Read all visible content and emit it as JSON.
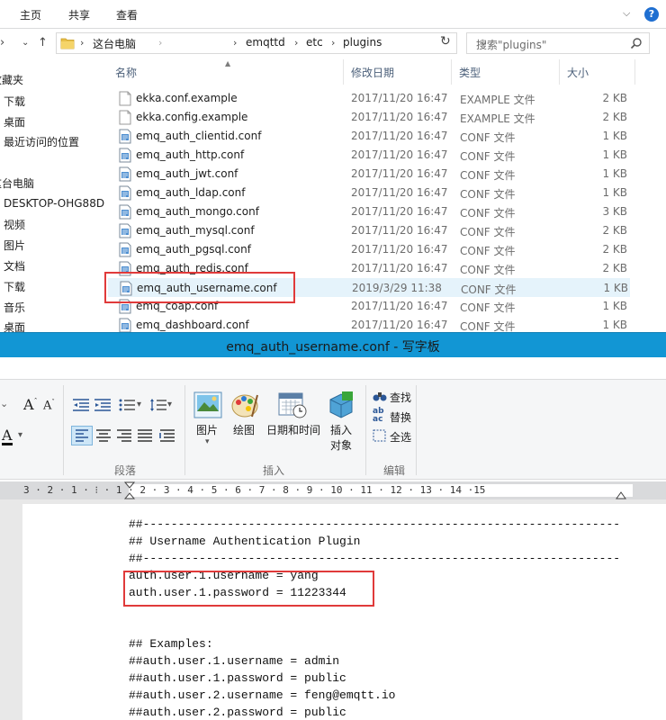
{
  "explorer": {
    "ribbon_tabs": [
      "主页",
      "共享",
      "查看"
    ],
    "address": {
      "root": "这台电脑",
      "segments": [
        "emqttd",
        "etc",
        "plugins"
      ]
    },
    "search_placeholder": "搜索\"plugins\"",
    "sidebar": {
      "quick_access": "收藏夹",
      "favorites": [
        "下载",
        "桌面",
        "最近访问的位置"
      ],
      "this_pc": "这台电脑",
      "pc_items": [
        "DESKTOP-OHG88D",
        "视频",
        "图片",
        "文档",
        "下载",
        "音乐",
        "桌面"
      ]
    },
    "columns": {
      "name": "名称",
      "date": "修改日期",
      "type": "类型",
      "size": "大小"
    },
    "files": [
      {
        "name": "ekka.conf.example",
        "date": "2017/11/20 16:47",
        "type": "EXAMPLE 文件",
        "size": "2 KB"
      },
      {
        "name": "ekka.config.example",
        "date": "2017/11/20 16:47",
        "type": "EXAMPLE 文件",
        "size": "2 KB"
      },
      {
        "name": "emq_auth_clientid.conf",
        "date": "2017/11/20 16:47",
        "type": "CONF 文件",
        "size": "1 KB"
      },
      {
        "name": "emq_auth_http.conf",
        "date": "2017/11/20 16:47",
        "type": "CONF 文件",
        "size": "1 KB"
      },
      {
        "name": "emq_auth_jwt.conf",
        "date": "2017/11/20 16:47",
        "type": "CONF 文件",
        "size": "1 KB"
      },
      {
        "name": "emq_auth_ldap.conf",
        "date": "2017/11/20 16:47",
        "type": "CONF 文件",
        "size": "1 KB"
      },
      {
        "name": "emq_auth_mongo.conf",
        "date": "2017/11/20 16:47",
        "type": "CONF 文件",
        "size": "3 KB"
      },
      {
        "name": "emq_auth_mysql.conf",
        "date": "2017/11/20 16:47",
        "type": "CONF 文件",
        "size": "2 KB"
      },
      {
        "name": "emq_auth_pgsql.conf",
        "date": "2017/11/20 16:47",
        "type": "CONF 文件",
        "size": "2 KB"
      },
      {
        "name": "emq_auth_redis.conf",
        "date": "2017/11/20 16:47",
        "type": "CONF 文件",
        "size": "2 KB"
      },
      {
        "name": "emq_auth_username.conf",
        "date": "2019/3/29 11:38",
        "type": "CONF 文件",
        "size": "1 KB"
      },
      {
        "name": "emq_coap.conf",
        "date": "2017/11/20 16:47",
        "type": "CONF 文件",
        "size": "1 KB"
      },
      {
        "name": "emq_dashboard.conf",
        "date": "2017/11/20 16:47",
        "type": "CONF 文件",
        "size": "1 KB"
      }
    ]
  },
  "wordpad": {
    "title": "emq_auth_username.conf - 写字板",
    "ribbon": {
      "paragraph_group": "段落",
      "insert_group": "插入",
      "edit_group": "编辑",
      "picture": "图片",
      "paint": "绘图",
      "datetime": "日期和时间",
      "insert_object_1": "插入",
      "insert_object_2": "对象",
      "find": "查找",
      "replace": "替换",
      "select_all": "全选"
    },
    "ruler": "3 · 2 · 1 · ⁝ · 1 · 2 · 3 · 4 · 5 · 6 · 7 · 8 · 9 · 10 · 11 · 12 · 13 · 14 ·15",
    "document_lines": [
      "##--------------------------------------------------------------------",
      "## Username Authentication Plugin",
      "##--------------------------------------------------------------------",
      "auth.user.1.username = yang",
      "auth.user.1.password = 11223344",
      "",
      "",
      "## Examples:",
      "##auth.user.1.username = admin",
      "##auth.user.1.password = public",
      "##auth.user.2.username = feng@emqtt.io",
      "##auth.user.2.password = public"
    ]
  },
  "colors": {
    "highlight_red": "#e03a3a",
    "title_bar_blue": "#1296d4",
    "selection_bg": "#e5f3fb"
  }
}
